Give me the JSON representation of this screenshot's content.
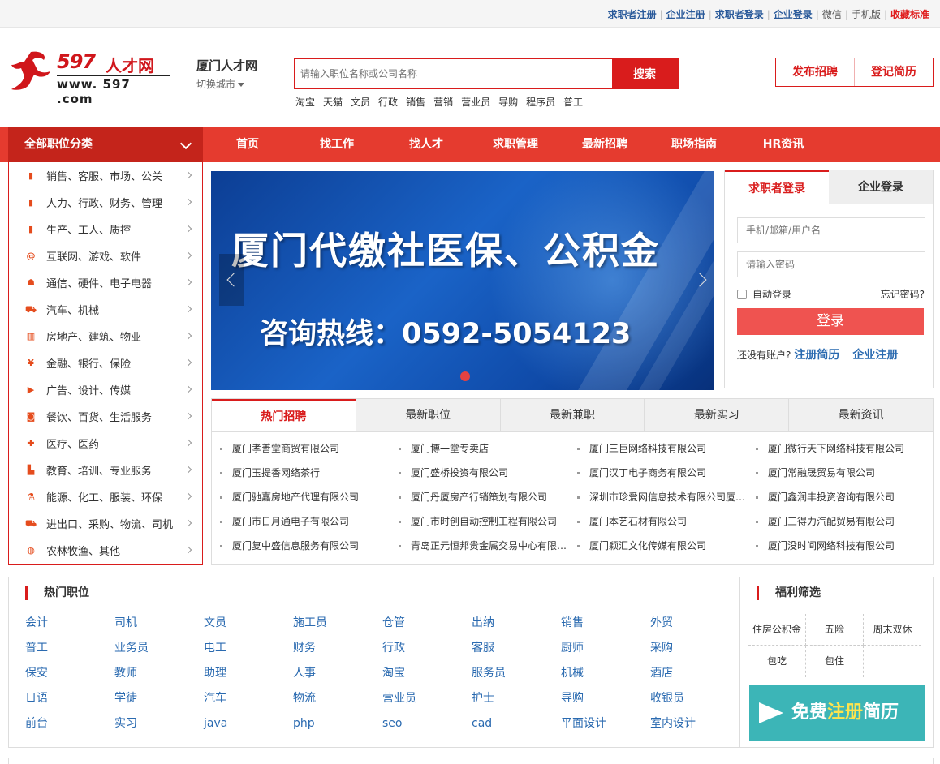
{
  "topbar": {
    "links": [
      {
        "label": "求职者注册",
        "style": "l"
      },
      {
        "label": "企业注册",
        "style": "l"
      },
      {
        "label": "求职者登录",
        "style": "l"
      },
      {
        "label": "企业登录",
        "style": "l"
      },
      {
        "label": "微信",
        "style": "gray"
      },
      {
        "label": "手机版",
        "style": "gray"
      },
      {
        "label": "收藏标准",
        "style": "red"
      }
    ]
  },
  "logo": {
    "num": "597",
    "cn": "人才网",
    "www": "www. 597 .com"
  },
  "city": {
    "title": "厦门人才网",
    "switch": "切换城市"
  },
  "search": {
    "placeholder": "请输入职位名称或公司名称",
    "button": "搜索"
  },
  "hot_keywords": [
    "淘宝",
    "天猫",
    "文员",
    "行政",
    "销售",
    "营销",
    "营业员",
    "导购",
    "程序员",
    "普工"
  ],
  "header_buttons": [
    "发布招聘",
    "登记简历"
  ],
  "nav": {
    "all_label": "全部职位分类",
    "items": [
      "首页",
      "找工作",
      "找人才",
      "求职管理",
      "最新招聘",
      "职场指南",
      "HR资讯"
    ]
  },
  "categories": [
    {
      "label": "销售、客服、市场、公关",
      "icon": "bookmark-icon",
      "glyph": "▮"
    },
    {
      "label": "人力、行政、财务、管理",
      "icon": "bookmark-icon",
      "glyph": "▮"
    },
    {
      "label": "生产、工人、质控",
      "icon": "bookmark-icon",
      "glyph": "▮"
    },
    {
      "label": "互联网、游戏、软件",
      "icon": "at-icon",
      "glyph": "@"
    },
    {
      "label": "通信、硬件、电子电器",
      "icon": "router-icon",
      "glyph": "☗"
    },
    {
      "label": "汽车、机械",
      "icon": "car-icon",
      "glyph": "⛟"
    },
    {
      "label": "房地产、建筑、物业",
      "icon": "building-icon",
      "glyph": "▥"
    },
    {
      "label": "金融、银行、保险",
      "icon": "yen-icon",
      "glyph": "¥"
    },
    {
      "label": "广告、设计、传媒",
      "icon": "video-icon",
      "glyph": "▶"
    },
    {
      "label": "餐饮、百货、生活服务",
      "icon": "bag-icon",
      "glyph": "◙"
    },
    {
      "label": "医疗、医药",
      "icon": "medical-icon",
      "glyph": "✚"
    },
    {
      "label": "教育、培训、专业服务",
      "icon": "book-icon",
      "glyph": "▙"
    },
    {
      "label": "能源、化工、服装、环保",
      "icon": "flask-icon",
      "glyph": "⚗"
    },
    {
      "label": "进出口、采购、物流、司机",
      "icon": "truck-icon",
      "glyph": "⛟"
    },
    {
      "label": "农林牧渔、其他",
      "icon": "globe-icon",
      "glyph": "◍"
    }
  ],
  "banner": {
    "headline": "厦门代缴社医保、公积金",
    "hotline": "咨询热线：0592-5054123"
  },
  "login": {
    "tabs": [
      "求职者登录",
      "企业登录"
    ],
    "username_placeholder": "手机/邮箱/用户名",
    "password_placeholder": "请输入密码",
    "remember": "自动登录",
    "forgot": "忘记密码?",
    "button": "登录",
    "no_account": "还没有账户?",
    "reg_resume": "注册简历",
    "reg_company": "企业注册"
  },
  "jobs": {
    "tabs": [
      "热门招聘",
      "最新职位",
      "最新兼职",
      "最新实习",
      "最新资讯"
    ],
    "list": [
      "厦门孝善堂商贸有限公司",
      "厦门博一堂专卖店",
      "厦门三巨网络科技有限公司",
      "厦门微行天下网络科技有限公司",
      "厦门玉提香网络茶行",
      "厦门盛桥投资有限公司",
      "厦门汉丁电子商务有限公司",
      "厦门常融晟贸易有限公司",
      "厦门驰嘉房地产代理有限公司",
      "厦门丹厦房产行销策划有限公司",
      "深圳市珍爱网信息技术有限公司厦门分公司",
      "厦门鑫润丰投资咨询有限公司",
      "厦门市日月通电子有限公司",
      "厦门市时创自动控制工程有限公司",
      "厦门本艺石材有限公司",
      "厦门三得力汽配贸易有限公司",
      "厦门复中盛信息服务有限公司",
      "青岛正元恒邦贵金属交易中心有限公司",
      "厦门颖汇文化传媒有限公司",
      "厦门没时间网络科技有限公司"
    ]
  },
  "hot_positions": {
    "title": "热门职位",
    "items": [
      "会计",
      "司机",
      "文员",
      "施工员",
      "仓管",
      "出纳",
      "销售",
      "外贸",
      "普工",
      "业务员",
      "电工",
      "财务",
      "行政",
      "客服",
      "厨师",
      "采购",
      "保安",
      "教师",
      "助理",
      "人事",
      "淘宝",
      "服务员",
      "机械",
      "酒店",
      "日语",
      "学徒",
      "汽车",
      "物流",
      "营业员",
      "护士",
      "导购",
      "收银员",
      "前台",
      "实习",
      "java",
      "php",
      "seo",
      "cad",
      "平面设计",
      "室内设计"
    ]
  },
  "welfare": {
    "title": "福利筛选",
    "tags": [
      "住房公积金",
      "五险",
      "周末双休",
      "包吃",
      "包住"
    ],
    "free_pre": "免费",
    "free_em": "注册",
    "free_post": "简历"
  },
  "colors": {
    "brand_red": "#d91c1c",
    "nav_red": "#e53b2f",
    "link_blue": "#2a6ab0",
    "teal": "#3cb5b7"
  }
}
